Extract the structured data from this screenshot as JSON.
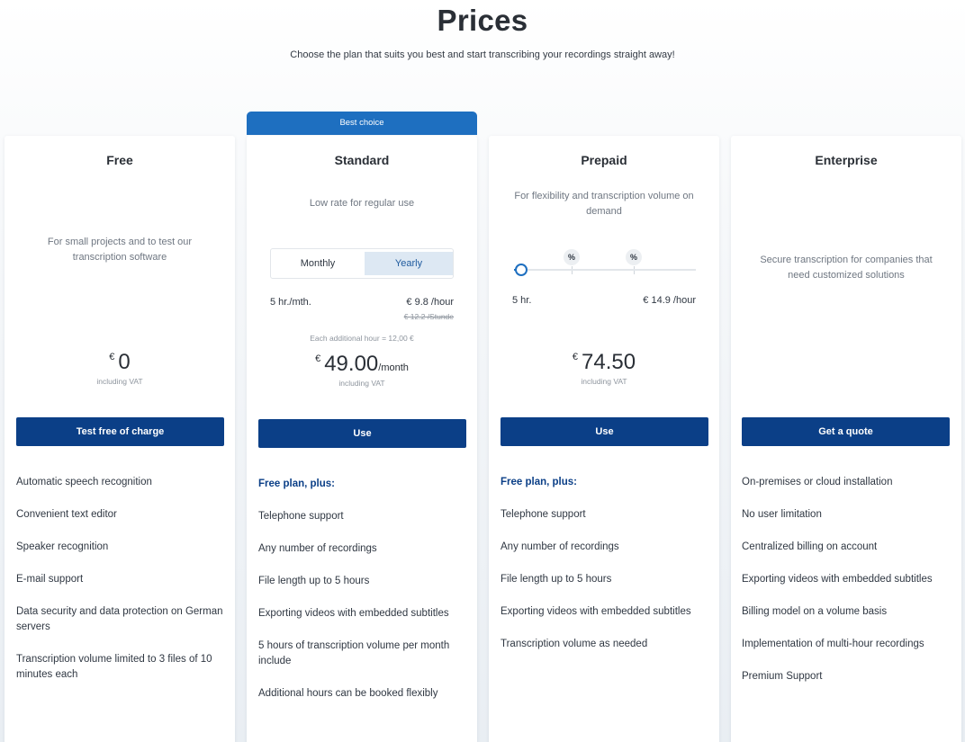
{
  "header": {
    "title": "Prices",
    "subtitle": "Choose the plan that suits you best and start transcribing your recordings straight away!"
  },
  "colors": {
    "accent": "#0b3f87",
    "badge": "#1e6fc0",
    "toggle_active": "#dde8f3"
  },
  "plans": {
    "free": {
      "name": "Free",
      "description": "For small projects and to test our transcription software",
      "currency": "€",
      "price": "0",
      "vat": "including VAT",
      "button": "Test free of charge",
      "features": [
        "Automatic speech recognition",
        "Convenient text editor",
        "Speaker recognition",
        "E-mail support",
        "Data security and data protection on German servers",
        "Transcription volume limited to 3 files of 10 minutes each"
      ]
    },
    "standard": {
      "badge": "Best choice",
      "name": "Standard",
      "description": "Low rate for regular use",
      "toggle": {
        "monthly": "Monthly",
        "yearly": "Yearly",
        "selected": "Yearly"
      },
      "hours": "5 hr./mth.",
      "rate": "€ 9.8 /hour",
      "old_rate": "€ 12.2 /Stunde",
      "additional": "Each additional hour = 12,00 €",
      "currency": "€",
      "price": "49.00",
      "period": "/month",
      "vat": "including VAT",
      "button": "Use",
      "plus_label": "Free plan, plus:",
      "features": [
        "Telephone support",
        "Any number of recordings",
        "File length up to 5 hours",
        "Exporting videos with embedded subtitles",
        "5 hours of transcription volume per month include",
        "Additional hours can be booked flexibly"
      ]
    },
    "prepaid": {
      "name": "Prepaid",
      "description": "For flexibility and transcription volume on demand",
      "slider_marks": [
        "%",
        "%"
      ],
      "hours": "5 hr.",
      "rate": "€ 14.9 /hour",
      "currency": "€",
      "price": "74.50",
      "vat": "including VAT",
      "button": "Use",
      "plus_label": "Free plan, plus:",
      "features": [
        "Telephone support",
        "Any number of recordings",
        "File length up to 5 hours",
        "Exporting videos with embedded subtitles",
        "Transcription volume as needed"
      ]
    },
    "enterprise": {
      "name": "Enterprise",
      "description": "Secure transcription for companies that need customized solutions",
      "button": "Get a quote",
      "features": [
        "On-premises or cloud installation",
        "No user limitation",
        "Centralized billing on account",
        "Exporting videos with embedded subtitles",
        "Billing model on a volume basis",
        "Implementation of multi-hour recordings",
        "Premium Support"
      ]
    }
  }
}
